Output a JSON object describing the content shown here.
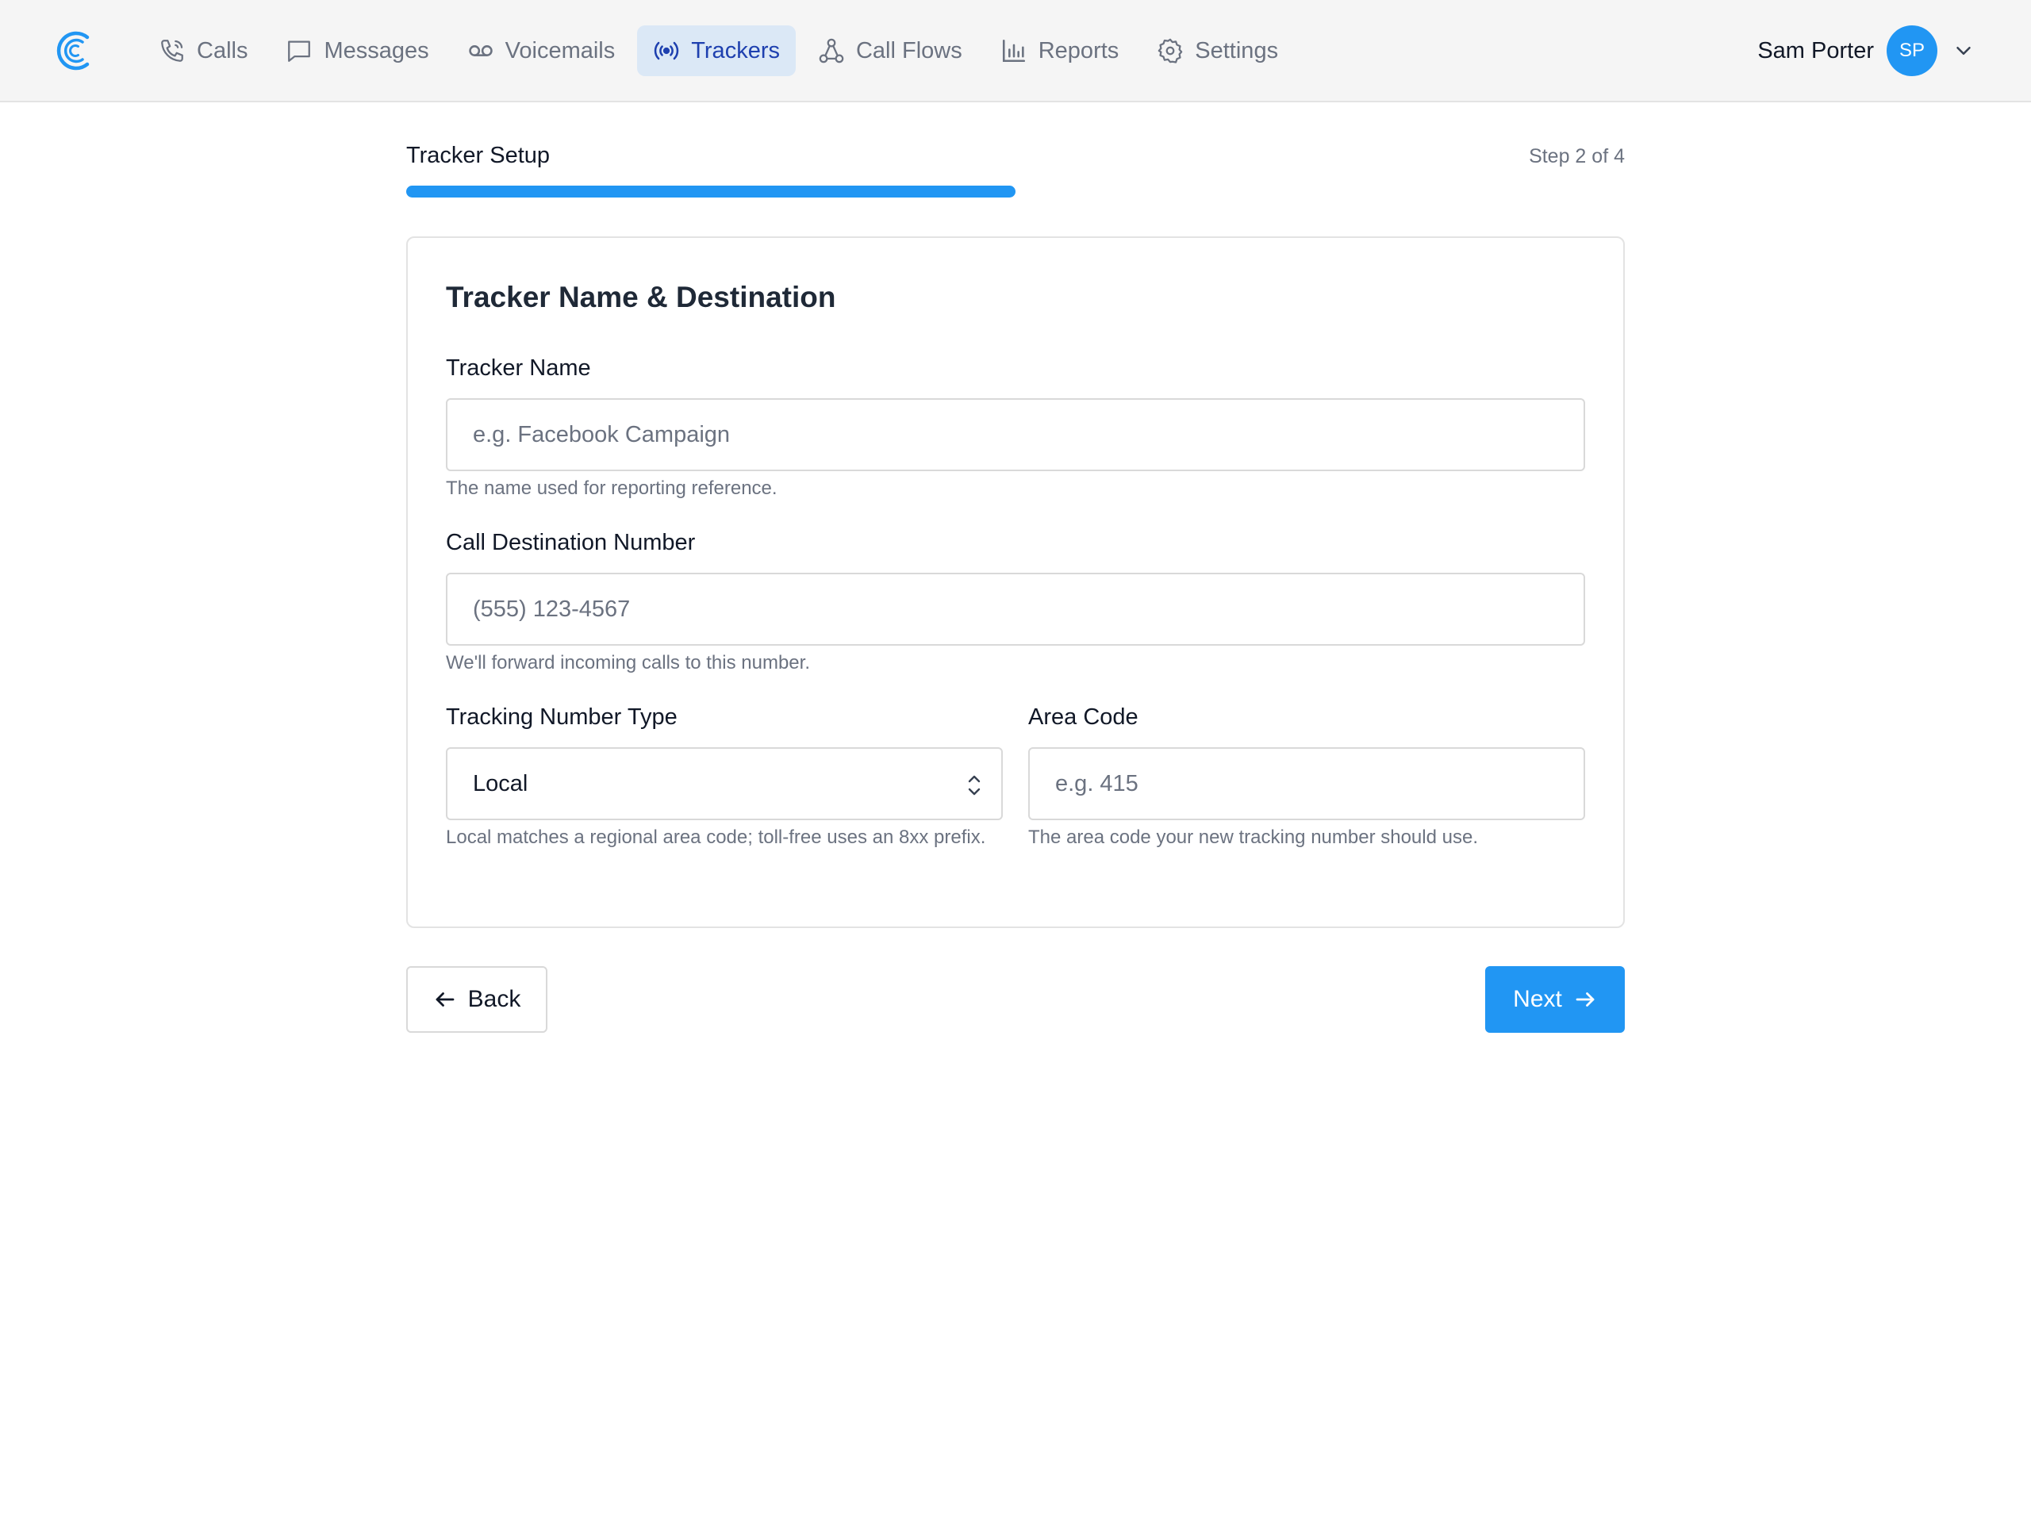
{
  "nav": {
    "items": [
      {
        "label": "Calls",
        "icon": "phone-icon",
        "active": false
      },
      {
        "label": "Messages",
        "icon": "message-icon",
        "active": false
      },
      {
        "label": "Voicemails",
        "icon": "voicemail-icon",
        "active": false
      },
      {
        "label": "Trackers",
        "icon": "broadcast-icon",
        "active": true
      },
      {
        "label": "Call Flows",
        "icon": "flow-icon",
        "active": false
      },
      {
        "label": "Reports",
        "icon": "bar-chart-icon",
        "active": false
      },
      {
        "label": "Settings",
        "icon": "gear-icon",
        "active": false
      }
    ],
    "user_name": "Sam Porter",
    "user_initials": "SP"
  },
  "wizard": {
    "title": "Tracker Setup",
    "step_label": "Step 2 of 4",
    "progress_fraction": 0.5
  },
  "form": {
    "heading": "Tracker Name & Destination",
    "tracker_name": {
      "label": "Tracker Name",
      "value": "",
      "placeholder": "e.g. Facebook Campaign",
      "help": "The name used for reporting reference."
    },
    "destination": {
      "label": "Call Destination Number",
      "value": "",
      "placeholder": "(555) 123-4567",
      "help": "We'll forward incoming calls to this number."
    },
    "number_type": {
      "label": "Tracking Number Type",
      "selected": "Local",
      "help": "Local matches a regional area code; toll-free uses an 8xx prefix."
    },
    "area_code": {
      "label": "Area Code",
      "value": "",
      "placeholder": "e.g. 415",
      "help": "The area code your new tracking number should use."
    }
  },
  "actions": {
    "back_label": "Back",
    "next_label": "Next"
  },
  "colors": {
    "accent": "#2196f3",
    "active_nav_bg": "#dbe8f6",
    "active_nav_text": "#1e40af"
  }
}
